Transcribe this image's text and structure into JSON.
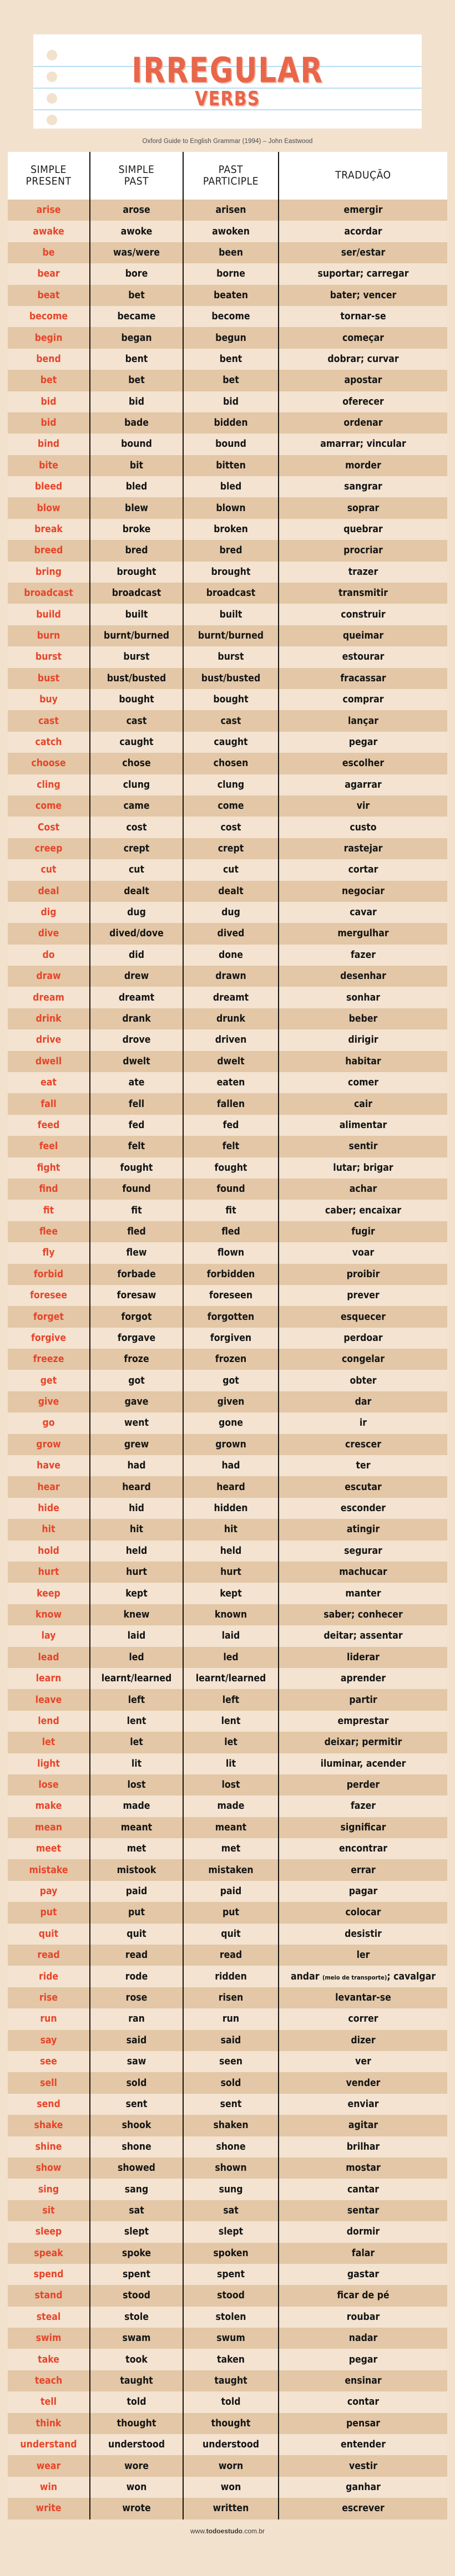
{
  "header": {
    "title_main": "IRREGULAR",
    "title_sub": "VERBS",
    "source": "Oxford Guide to English Grammar (1994) – John Eastwood"
  },
  "footer": {
    "site_pre": "www.",
    "site_bold": "todoestudo",
    "site_post": ".com.br"
  },
  "table": {
    "columns": [
      {
        "line1": "SIMPLE",
        "line2": "PRESENT"
      },
      {
        "line1": "SIMPLE",
        "line2": "PAST"
      },
      {
        "line1": "PAST",
        "line2": "PARTICIPLE"
      },
      {
        "line1": "TRADUÇÃO",
        "line2": ""
      }
    ],
    "rows": [
      {
        "base": "arise",
        "past": "arose",
        "participle": "arisen",
        "translation": "emergir"
      },
      {
        "base": "awake",
        "past": "awoke",
        "participle": "awoken",
        "translation": "acordar"
      },
      {
        "base": "be",
        "past": "was/were",
        "participle": "been",
        "translation": "ser/estar"
      },
      {
        "base": "bear",
        "past": "bore",
        "participle": "borne",
        "translation": "suportar; carregar"
      },
      {
        "base": "beat",
        "past": "bet",
        "participle": "beaten",
        "translation": "bater; vencer"
      },
      {
        "base": "become",
        "past": "became",
        "participle": "become",
        "translation": "tornar-se"
      },
      {
        "base": "begin",
        "past": "began",
        "participle": "begun",
        "translation": "começar"
      },
      {
        "base": "bend",
        "past": "bent",
        "participle": "bent",
        "translation": "dobrar; curvar"
      },
      {
        "base": "bet",
        "past": "bet",
        "participle": "bet",
        "translation": "apostar"
      },
      {
        "base": "bid",
        "past": "bid",
        "participle": "bid",
        "translation": "oferecer"
      },
      {
        "base": "bid",
        "past": "bade",
        "participle": "bidden",
        "translation": "ordenar"
      },
      {
        "base": "bind",
        "past": "bound",
        "participle": "bound",
        "translation": "amarrar; vincular"
      },
      {
        "base": "bite",
        "past": "bit",
        "participle": "bitten",
        "translation": "morder"
      },
      {
        "base": "bleed",
        "past": "bled",
        "participle": "bled",
        "translation": "sangrar"
      },
      {
        "base": "blow",
        "past": "blew",
        "participle": "blown",
        "translation": "soprar"
      },
      {
        "base": "break",
        "past": "broke",
        "participle": "broken",
        "translation": "quebrar"
      },
      {
        "base": "breed",
        "past": "bred",
        "participle": "bred",
        "translation": "procriar"
      },
      {
        "base": "bring",
        "past": "brought",
        "participle": "brought",
        "translation": "trazer"
      },
      {
        "base": "broadcast",
        "past": "broadcast",
        "participle": "broadcast",
        "translation": "transmitir"
      },
      {
        "base": "build",
        "past": "built",
        "participle": "built",
        "translation": "construir"
      },
      {
        "base": "burn",
        "past": "burnt/burned",
        "participle": "burnt/burned",
        "translation": "queimar"
      },
      {
        "base": "burst",
        "past": "burst",
        "participle": "burst",
        "translation": "estourar"
      },
      {
        "base": "bust",
        "past": "bust/busted",
        "participle": "bust/busted",
        "translation": "fracassar"
      },
      {
        "base": "buy",
        "past": "bought",
        "participle": "bought",
        "translation": "comprar"
      },
      {
        "base": "cast",
        "past": "cast",
        "participle": "cast",
        "translation": "lançar"
      },
      {
        "base": "catch",
        "past": "caught",
        "participle": "caught",
        "translation": "pegar"
      },
      {
        "base": "choose",
        "past": "chose",
        "participle": "chosen",
        "translation": "escolher"
      },
      {
        "base": "cling",
        "past": "clung",
        "participle": "clung",
        "translation": "agarrar"
      },
      {
        "base": "come",
        "past": "came",
        "participle": "come",
        "translation": "vir"
      },
      {
        "base": "Cost",
        "past": "cost",
        "participle": "cost",
        "translation": "custo"
      },
      {
        "base": "creep",
        "past": "crept",
        "participle": "crept",
        "translation": "rastejar"
      },
      {
        "base": "cut",
        "past": "cut",
        "participle": "cut",
        "translation": "cortar"
      },
      {
        "base": "deal",
        "past": "dealt",
        "participle": "dealt",
        "translation": "negociar"
      },
      {
        "base": "dig",
        "past": "dug",
        "participle": "dug",
        "translation": "cavar"
      },
      {
        "base": "dive",
        "past": "dived/dove",
        "participle": "dived",
        "translation": "mergulhar"
      },
      {
        "base": "do",
        "past": "did",
        "participle": "done",
        "translation": "fazer"
      },
      {
        "base": "draw",
        "past": "drew",
        "participle": "drawn",
        "translation": "desenhar"
      },
      {
        "base": "dream",
        "past": "dreamt",
        "participle": "dreamt",
        "translation": "sonhar"
      },
      {
        "base": "drink",
        "past": "drank",
        "participle": "drunk",
        "translation": "beber"
      },
      {
        "base": "drive",
        "past": "drove",
        "participle": "driven",
        "translation": "dirigir"
      },
      {
        "base": "dwell",
        "past": "dwelt",
        "participle": "dwelt",
        "translation": "habitar"
      },
      {
        "base": "eat",
        "past": "ate",
        "participle": "eaten",
        "translation": "comer"
      },
      {
        "base": "fall",
        "past": "fell",
        "participle": "fallen",
        "translation": "cair"
      },
      {
        "base": "feed",
        "past": "fed",
        "participle": "fed",
        "translation": "alimentar"
      },
      {
        "base": "feel",
        "past": "felt",
        "participle": "felt",
        "translation": "sentir"
      },
      {
        "base": "fight",
        "past": "fought",
        "participle": "fought",
        "translation": "lutar; brigar"
      },
      {
        "base": "find",
        "past": "found",
        "participle": "found",
        "translation": "achar"
      },
      {
        "base": "fit",
        "past": "fit",
        "participle": "fit",
        "translation": "caber; encaixar"
      },
      {
        "base": "flee",
        "past": "fled",
        "participle": "fled",
        "translation": "fugir"
      },
      {
        "base": "fly",
        "past": "flew",
        "participle": "flown",
        "translation": "voar"
      },
      {
        "base": "forbid",
        "past": "forbade",
        "participle": "forbidden",
        "translation": "proibir"
      },
      {
        "base": "foresee",
        "past": "foresaw",
        "participle": "foreseen",
        "translation": "prever"
      },
      {
        "base": "forget",
        "past": "forgot",
        "participle": "forgotten",
        "translation": "esquecer"
      },
      {
        "base": "forgive",
        "past": "forgave",
        "participle": "forgiven",
        "translation": "perdoar"
      },
      {
        "base": "freeze",
        "past": "froze",
        "participle": "frozen",
        "translation": "congelar"
      },
      {
        "base": "get",
        "past": "got",
        "participle": "got",
        "translation": "obter"
      },
      {
        "base": "give",
        "past": "gave",
        "participle": "given",
        "translation": "dar"
      },
      {
        "base": "go",
        "past": "went",
        "participle": "gone",
        "translation": "ir"
      },
      {
        "base": "grow",
        "past": "grew",
        "participle": "grown",
        "translation": "crescer"
      },
      {
        "base": "have",
        "past": "had",
        "participle": "had",
        "translation": "ter"
      },
      {
        "base": "hear",
        "past": "heard",
        "participle": "heard",
        "translation": "escutar"
      },
      {
        "base": "hide",
        "past": "hid",
        "participle": "hidden",
        "translation": "esconder"
      },
      {
        "base": "hit",
        "past": "hit",
        "participle": "hit",
        "translation": "atingir"
      },
      {
        "base": "hold",
        "past": "held",
        "participle": "held",
        "translation": "segurar"
      },
      {
        "base": "hurt",
        "past": "hurt",
        "participle": "hurt",
        "translation": "machucar"
      },
      {
        "base": "keep",
        "past": "kept",
        "participle": "kept",
        "translation": "manter"
      },
      {
        "base": "know",
        "past": "knew",
        "participle": "known",
        "translation": "saber; conhecer"
      },
      {
        "base": "lay",
        "past": "laid",
        "participle": "laid",
        "translation": "deitar; assentar"
      },
      {
        "base": "lead",
        "past": "led",
        "participle": "led",
        "translation": "liderar"
      },
      {
        "base": "learn",
        "past": "learnt/learned",
        "participle": "learnt/learned",
        "translation": "aprender"
      },
      {
        "base": "leave",
        "past": "left",
        "participle": "left",
        "translation": "partir"
      },
      {
        "base": "lend",
        "past": "lent",
        "participle": "lent",
        "translation": "emprestar"
      },
      {
        "base": "let",
        "past": "let",
        "participle": "let",
        "translation": "deixar; permitir"
      },
      {
        "base": "light",
        "past": "lit",
        "participle": "lit",
        "translation": "iluminar, acender"
      },
      {
        "base": "lose",
        "past": "lost",
        "participle": "lost",
        "translation": "perder"
      },
      {
        "base": "make",
        "past": "made",
        "participle": "made",
        "translation": "fazer"
      },
      {
        "base": "mean",
        "past": "meant",
        "participle": "meant",
        "translation": "significar"
      },
      {
        "base": "meet",
        "past": "met",
        "participle": "met",
        "translation": "encontrar"
      },
      {
        "base": "mistake",
        "past": "mistook",
        "participle": "mistaken",
        "translation": "errar"
      },
      {
        "base": "pay",
        "past": "paid",
        "participle": "paid",
        "translation": "pagar"
      },
      {
        "base": "put",
        "past": "put",
        "participle": "put",
        "translation": "colocar"
      },
      {
        "base": "quit",
        "past": "quit",
        "participle": "quit",
        "translation": "desistir"
      },
      {
        "base": "read",
        "past": "read",
        "participle": "read",
        "translation": "ler"
      },
      {
        "base": "ride",
        "past": "rode",
        "participle": "ridden",
        "translation": "andar",
        "translation_note": "(meio de transporte)",
        "translation_tail": "; cavalgar"
      },
      {
        "base": "rise",
        "past": "rose",
        "participle": "risen",
        "translation": "levantar-se"
      },
      {
        "base": "run",
        "past": "ran",
        "participle": "run",
        "translation": "correr"
      },
      {
        "base": "say",
        "past": "said",
        "participle": "said",
        "translation": "dizer"
      },
      {
        "base": "see",
        "past": "saw",
        "participle": "seen",
        "translation": "ver"
      },
      {
        "base": "sell",
        "past": "sold",
        "participle": "sold",
        "translation": "vender"
      },
      {
        "base": "send",
        "past": "sent",
        "participle": "sent",
        "translation": "enviar"
      },
      {
        "base": "shake",
        "past": "shook",
        "participle": "shaken",
        "translation": "agitar"
      },
      {
        "base": "shine",
        "past": "shone",
        "participle": "shone",
        "translation": "brilhar"
      },
      {
        "base": "show",
        "past": "showed",
        "participle": "shown",
        "translation": "mostar"
      },
      {
        "base": "sing",
        "past": "sang",
        "participle": "sung",
        "translation": "cantar"
      },
      {
        "base": "sit",
        "past": "sat",
        "participle": "sat",
        "translation": "sentar"
      },
      {
        "base": "sleep",
        "past": "slept",
        "participle": "slept",
        "translation": "dormir"
      },
      {
        "base": "speak",
        "past": "spoke",
        "participle": "spoken",
        "translation": "falar"
      },
      {
        "base": "spend",
        "past": "spent",
        "participle": "spent",
        "translation": "gastar"
      },
      {
        "base": "stand",
        "past": "stood",
        "participle": "stood",
        "translation": "ficar de pé"
      },
      {
        "base": "steal",
        "past": "stole",
        "participle": "stolen",
        "translation": "roubar"
      },
      {
        "base": "swim",
        "past": "swam",
        "participle": "swum",
        "translation": "nadar"
      },
      {
        "base": "take",
        "past": "took",
        "participle": "taken",
        "translation": "pegar"
      },
      {
        "base": "teach",
        "past": "taught",
        "participle": "taught",
        "translation": "ensinar"
      },
      {
        "base": "tell",
        "past": "told",
        "participle": "told",
        "translation": "contar"
      },
      {
        "base": "think",
        "past": "thought",
        "participle": "thought",
        "translation": "pensar"
      },
      {
        "base": "understand",
        "past": "understood",
        "participle": "understood",
        "translation": "entender"
      },
      {
        "base": "wear",
        "past": "wore",
        "participle": "worn",
        "translation": "vestir"
      },
      {
        "base": "win",
        "past": "won",
        "participle": "won",
        "translation": "ganhar"
      },
      {
        "base": "write",
        "past": "wrote",
        "participle": "written",
        "translation": "escrever"
      }
    ]
  },
  "colors": {
    "page_bg": "#f2e1cd",
    "accent": "#e8664a",
    "base_verb": "#e8442a",
    "row_odd": "#f3e3d0",
    "row_even": "#e3c7a6",
    "rule_line": "#b9ddf2",
    "divider": "#15110e"
  }
}
